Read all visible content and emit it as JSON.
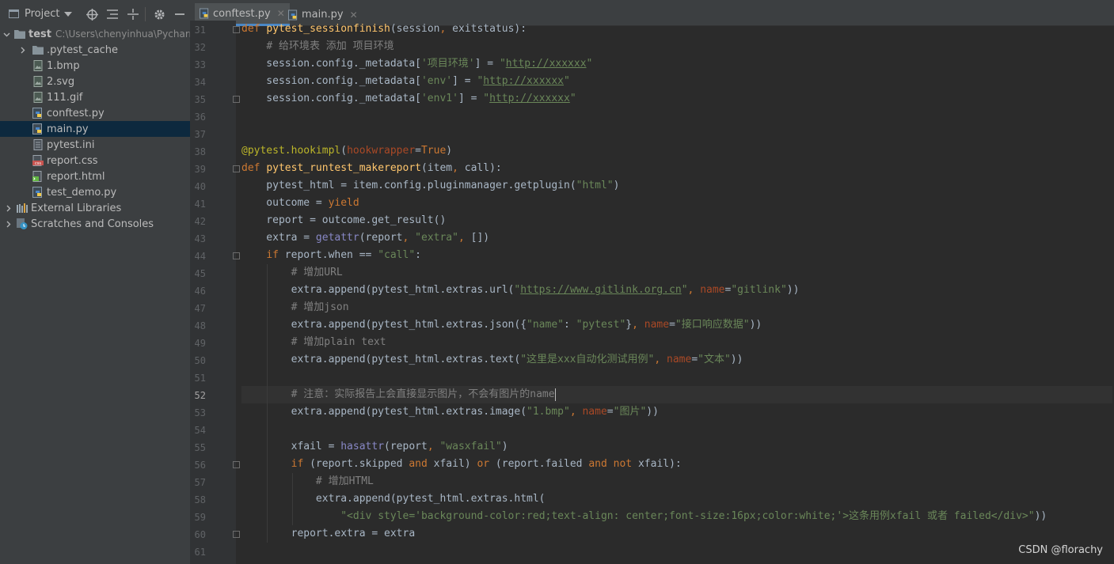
{
  "toolbar": {
    "project_label": "Project"
  },
  "tree": {
    "root_name": "test",
    "root_path": "C:\\Users\\chenyinhua\\Pycharm",
    "items": [
      {
        "label": ".pytest_cache",
        "kind": "folder"
      },
      {
        "label": "1.bmp",
        "kind": "image"
      },
      {
        "label": "2.svg",
        "kind": "image"
      },
      {
        "label": "111.gif",
        "kind": "image"
      },
      {
        "label": "conftest.py",
        "kind": "python"
      },
      {
        "label": "main.py",
        "kind": "python",
        "selected": true
      },
      {
        "label": "pytest.ini",
        "kind": "ini"
      },
      {
        "label": "report.css",
        "kind": "css"
      },
      {
        "label": "report.html",
        "kind": "html"
      },
      {
        "label": "test_demo.py",
        "kind": "python"
      }
    ],
    "external_libraries": "External Libraries",
    "scratches": "Scratches and Consoles"
  },
  "tabs": [
    {
      "label": "conftest.py",
      "active": true
    },
    {
      "label": "main.py",
      "active": false
    }
  ],
  "editor": {
    "current_line": "52",
    "line_numbers": [
      "31",
      "32",
      "33",
      "34",
      "35",
      "36",
      "37",
      "38",
      "39",
      "40",
      "41",
      "42",
      "43",
      "44",
      "45",
      "46",
      "47",
      "48",
      "49",
      "50",
      "51",
      "52",
      "53",
      "54",
      "55",
      "56",
      "57",
      "58",
      "59",
      "60",
      "61"
    ],
    "lines": [
      "def pytest_sessionfinish(session, exitstatus):",
      "    # 给环境表 添加 项目环境",
      "    session.config._metadata['项目环境'] = \"http://xxxxxx\"",
      "    session.config._metadata['env'] = \"http://xxxxxx\"",
      "    session.config._metadata['env1'] = \"http://xxxxxx\"",
      "",
      "",
      "@pytest.hookimpl(hookwrapper=True)",
      "def pytest_runtest_makereport(item, call):",
      "    pytest_html = item.config.pluginmanager.getplugin(\"html\")",
      "    outcome = yield",
      "    report = outcome.get_result()",
      "    extra = getattr(report, \"extra\", [])",
      "    if report.when == \"call\":",
      "        # 增加URL",
      "        extra.append(pytest_html.extras.url(\"https://www.gitlink.org.cn\", name=\"gitlink\"))",
      "        # 增加json",
      "        extra.append(pytest_html.extras.json({\"name\": \"pytest\"}, name=\"接口响应数据\"))",
      "        # 增加plain text",
      "        extra.append(pytest_html.extras.text(\"这里是xxx自动化测试用例\", name=\"文本\"))",
      "",
      "        # 注意：实际报告上会直接显示图片，不会有图片的name",
      "        extra.append(pytest_html.extras.image(\"1.bmp\", name=\"图片\"))",
      "",
      "        xfail = hasattr(report, \"wasxfail\")",
      "        if (report.skipped and xfail) or (report.failed and not xfail):",
      "            # 增加HTML",
      "            extra.append(pytest_html.extras.html(",
      "                \"<div style='background-color:red;text-align: center;font-size:16px;color:white;'>这条用例xfail 或者 failed</div>\"))",
      "        report.extra = extra",
      ""
    ]
  },
  "watermark": "CSDN @florachy"
}
